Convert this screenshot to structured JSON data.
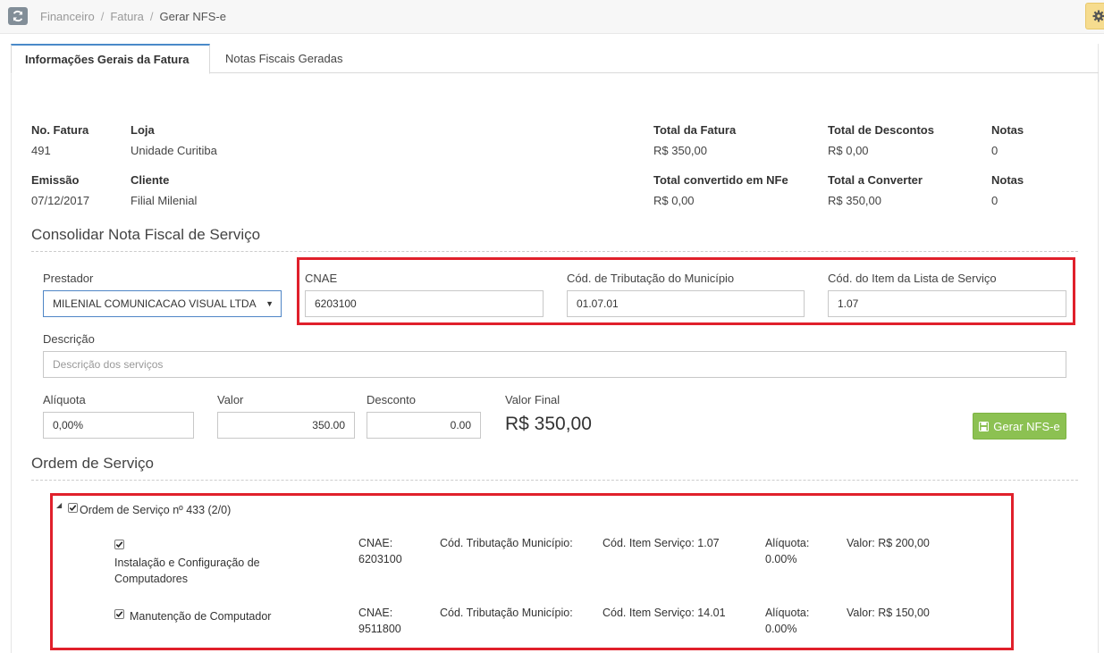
{
  "breadcrumb": [
    "Financeiro",
    "Fatura",
    "Gerar NFS-e"
  ],
  "tabs": [
    "Informações Gerais da Fatura",
    "Notas Fiscais Geradas"
  ],
  "info": {
    "no_fatura_label": "No. Fatura",
    "no_fatura": "491",
    "loja_label": "Loja",
    "loja": "Unidade Curitiba",
    "emissao_label": "Emissão",
    "emissao": "07/12/2017",
    "cliente_label": "Cliente",
    "cliente": "Filial Milenial",
    "total_fatura_label": "Total da Fatura",
    "total_fatura": "R$ 350,00",
    "total_descontos_label": "Total de Descontos",
    "total_descontos": "R$ 0,00",
    "notas_label": "Notas",
    "notas_1": "0",
    "total_convertido_label": "Total convertido em NFe",
    "total_convertido": "R$ 0,00",
    "total_converter_label": "Total a Converter",
    "total_converter": "R$ 350,00",
    "notas_2": "0"
  },
  "consolidar": {
    "title": "Consolidar Nota Fiscal de Serviço",
    "prestador_label": "Prestador",
    "prestador_value": "MILENIAL COMUNICACAO VISUAL LTDA",
    "cnae_label": "CNAE",
    "cnae_value": "6203100",
    "cod_trib_label": "Cód. de Tributação do Município",
    "cod_trib_value": "01.07.01",
    "cod_item_label": "Cód. do Item da Lista de Serviço",
    "cod_item_value": "1.07",
    "descricao_label": "Descrição",
    "descricao_placeholder": "Descrição dos serviços",
    "aliquota_label": "Alíquota",
    "aliquota_value": "0,00%",
    "valor_label": "Valor",
    "valor_value": "350.00",
    "desconto_label": "Desconto",
    "desconto_value": "0.00",
    "valor_final_label": "Valor Final",
    "valor_final_value": "R$ 350,00",
    "gerar_button": "Gerar NFS-e"
  },
  "ordem": {
    "title": "Ordem de Serviço",
    "root_label": "Ordem de Serviço nº 433 (2/0)",
    "items": [
      {
        "name_line1": "Instalação e Configuração de",
        "name_line2": "Computadores",
        "cnae_line1": "CNAE:",
        "cnae_line2": "6203100",
        "cod_trib": "Cód. Tributação Município:",
        "cod_item": "Cód. Item Serviço: 1.07",
        "aliquota_line1": "Alíquota:",
        "aliquota_line2": "0.00%",
        "valor": "Valor: R$ 200,00"
      },
      {
        "name_line1": "Manutenção de Computador",
        "cnae_line1": "CNAE:",
        "cnae_line2": "9511800",
        "cod_trib": "Cód. Tributação Município:",
        "cod_item": "Cód. Item Serviço: 14.01",
        "aliquota_line1": "Alíquota:",
        "aliquota_line2": "0.00%",
        "valor": "Valor: R$ 150,00"
      }
    ]
  },
  "colors": {
    "highlight": "#e0202b",
    "button_green": "#8cc152",
    "tab_accent": "#4a8ac9"
  }
}
